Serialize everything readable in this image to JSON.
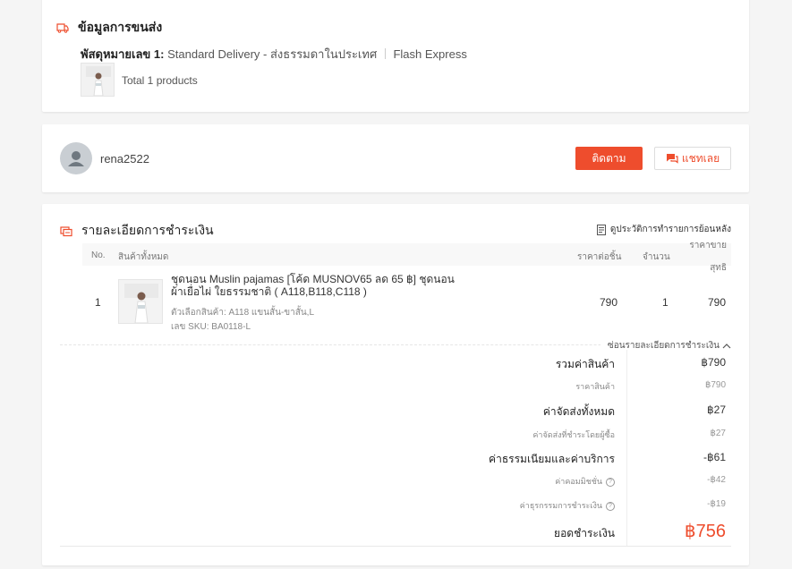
{
  "shipping": {
    "title": "ข้อมูลการขนส่ง",
    "parcel_label": "พัสดุหมายเลข 1:",
    "service": "Standard Delivery - ส่งธรรมดาในประเทศ",
    "carrier": "Flash Express",
    "total_products": "Total 1 products"
  },
  "seller": {
    "name": "rena2522",
    "follow_label": "ติดตาม",
    "chat_label": "แชทเลย"
  },
  "payment": {
    "title": "รายละเอียดการชำระเงิน",
    "history_link": "ดูประวัติการทำรายการย้อนหลัง",
    "columns": {
      "no": "No.",
      "all_products": "สินค้าทั้งหมด",
      "unit_price": "ราคาต่อชิ้น",
      "quantity": "จำนวน",
      "net_price_line1": "ราคาขาย",
      "net_price_line2": "สุทธิ"
    },
    "item": {
      "no": "1",
      "name": "ชุดนอน Muslin pajamas [โค้ด MUSNOV65 ลด 65 ฿] ชุดนอน ผ้าเยื่อไผ่ ใยธรรมชาติ ( A118,B118,C118 )",
      "variant": "ตัวเลือกสินค้า: A118 แขนสั้น-ขาสั้น,L",
      "sku": "เลข SKU: BA0118-L",
      "unit_price": "790",
      "quantity": "1",
      "net_price": "790"
    },
    "hide_details": "ซ่อนรายละเอียดการชำระเงิน",
    "summary": {
      "product_total_label": "รวมค่าสินค้า",
      "product_total": "฿790",
      "product_price_label": "ราคาสินค้า",
      "product_price": "฿790",
      "shipping_total_label": "ค่าจัดส่งทั้งหมด",
      "shipping_total": "฿27",
      "shipping_paid_label": "ค่าจัดส่งที่ชำระโดยผู้ซื้อ",
      "shipping_paid": "฿27",
      "fees_label": "ค่าธรรมเนียมและค่าบริการ",
      "fees": "-฿61",
      "commission_label": "ค่าคอมมิชชั่น",
      "commission": "-฿42",
      "transaction_fee_label": "ค่าธุรกรรมการชำระเงิน",
      "transaction_fee": "-฿19",
      "grand_total_label": "ยอดชำระเงิน",
      "grand_total": "฿756"
    }
  },
  "colors": {
    "accent": "#ee4d2d"
  }
}
